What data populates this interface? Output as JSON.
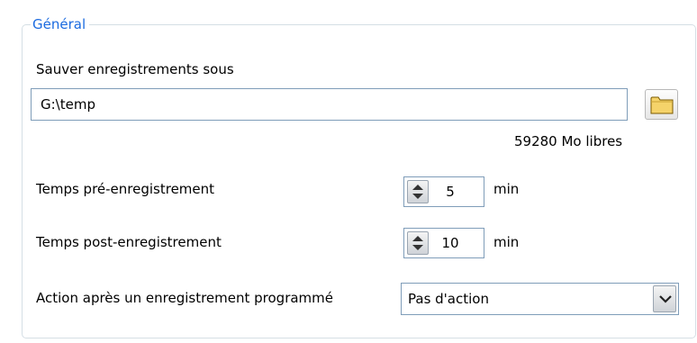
{
  "group": {
    "title": "Général"
  },
  "save_path": {
    "label": "Sauver enregistrements sous",
    "value": "G:\\temp",
    "browse_icon": "folder-icon",
    "free_space": "59280 Mo libres"
  },
  "pre_record": {
    "label": "Temps pré-enregistrement",
    "value": "5",
    "unit": "min"
  },
  "post_record": {
    "label": "Temps post-enregistrement",
    "value": "10",
    "unit": "min"
  },
  "after_action": {
    "label": "Action après un enregistrement programmé",
    "selected": "Pas d'action"
  },
  "colors": {
    "accent": "#1c6be0",
    "border": "#7f9db9",
    "group_border": "#d5dfe5",
    "folder": "#f5d36a"
  }
}
